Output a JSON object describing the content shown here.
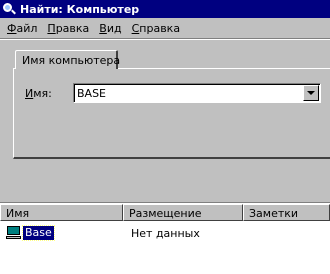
{
  "window": {
    "title": "Найти: Компьютер",
    "icon": "magnifier-icon"
  },
  "menu": [
    "Файл",
    "Правка",
    "Вид",
    "Справка"
  ],
  "tab": {
    "label": "Имя компьютера"
  },
  "form": {
    "name_label": "Имя:",
    "name_value": "BASE"
  },
  "results": {
    "columns": [
      "Имя",
      "Размещение",
      "Заметки"
    ],
    "rows": [
      {
        "icon": "computer-icon",
        "name": "Base",
        "location": "Нет данных",
        "notes": ""
      }
    ]
  },
  "colors": {
    "titlebar": "#000080",
    "window_bg": "#c0c0c0",
    "selection": "#000080"
  }
}
